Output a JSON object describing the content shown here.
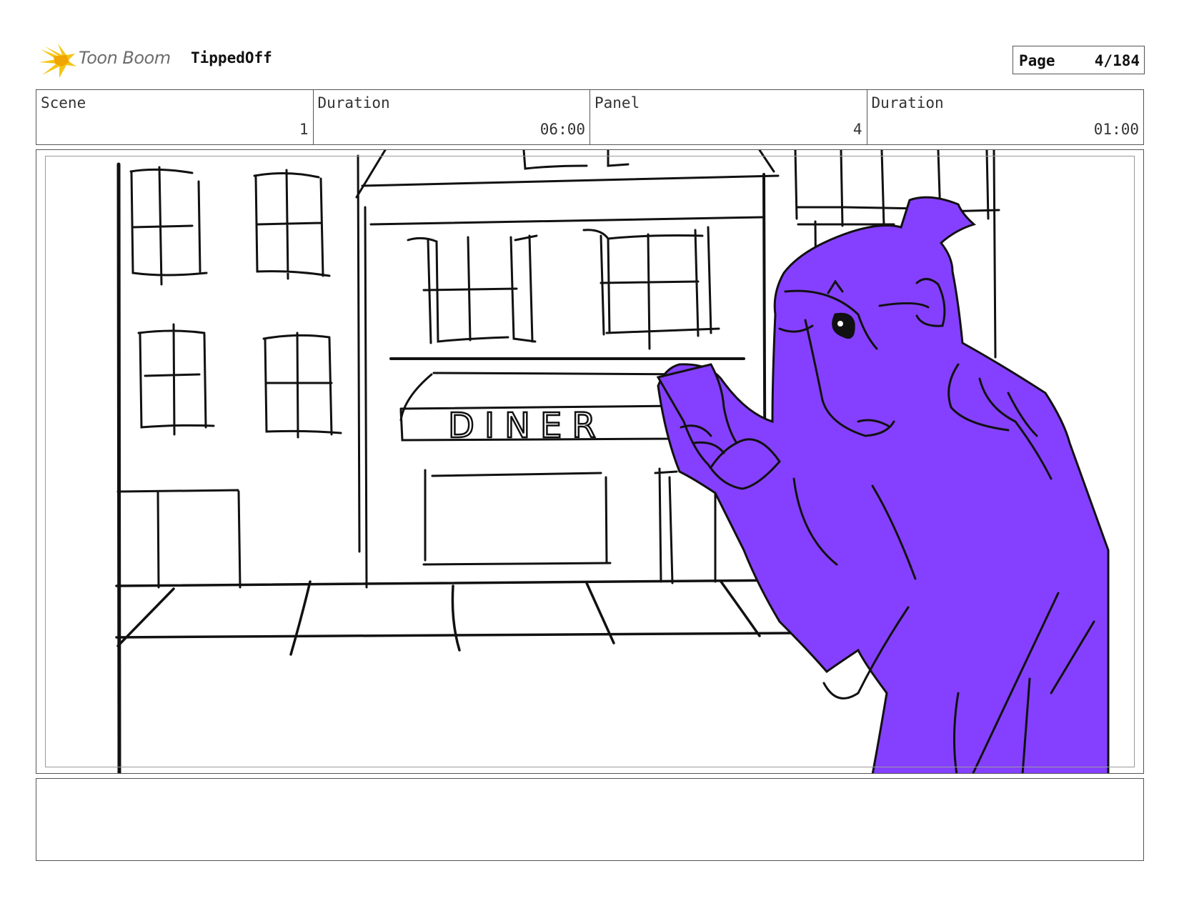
{
  "header": {
    "brand": "Toon Boom",
    "project": "TippedOff",
    "page_label": "Page",
    "page_value": "4/184"
  },
  "info": {
    "scene_label": "Scene",
    "scene_value": "1",
    "scene_duration_label": "Duration",
    "scene_duration_value": "06:00",
    "panel_label": "Panel",
    "panel_value": "4",
    "panel_duration_label": "Duration",
    "panel_duration_value": "01:00"
  },
  "panel": {
    "sign_text": "DINER",
    "character_color": "#8540ff",
    "logo_color": "#f5c518"
  },
  "notes": {
    "text": ""
  }
}
